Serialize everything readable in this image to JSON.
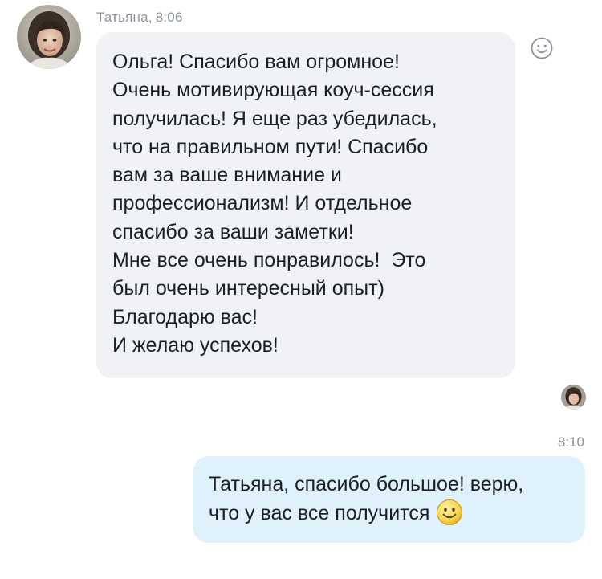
{
  "incoming": {
    "sender": "Татьяна",
    "time": "8:06",
    "lines": [
      "Ольга! Спасибо вам огромное!",
      "Очень мотивирующая коуч-сессия",
      "получилась! Я еще раз убедилась,",
      "что на правильном пути! Спасибо",
      "вам за ваше внимание и",
      "профессионализм! И отдельное",
      "спасибо за ваши заметки!",
      "Мне все очень понравилось!  Это",
      "был очень интересный опыт)",
      "Благодарю вас!",
      "И желаю успехов!"
    ]
  },
  "outgoing": {
    "time": "8:10",
    "lines": [
      "Татьяна, спасибо большое! верю,",
      "что у вас все получится"
    ]
  },
  "icons": {
    "reaction": "smile-outline-icon",
    "inline_emoji": "smiley-emoji-icon"
  },
  "colors": {
    "incoming_bubble": "#f0f2f5",
    "outgoing_bubble": "#dff1fb",
    "meta_text": "#8a9199"
  }
}
